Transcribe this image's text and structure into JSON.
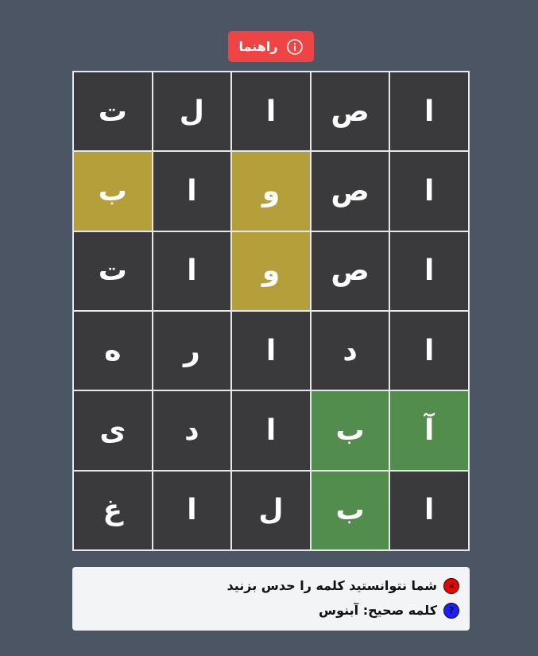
{
  "help_button": {
    "label": "راهنما",
    "icon": "info-icon"
  },
  "grid": [
    [
      {
        "letter": "ا",
        "state": "absent"
      },
      {
        "letter": "ص",
        "state": "absent"
      },
      {
        "letter": "ا",
        "state": "absent"
      },
      {
        "letter": "ل",
        "state": "absent"
      },
      {
        "letter": "ت",
        "state": "absent"
      }
    ],
    [
      {
        "letter": "ا",
        "state": "absent"
      },
      {
        "letter": "ص",
        "state": "absent"
      },
      {
        "letter": "و",
        "state": "present"
      },
      {
        "letter": "ا",
        "state": "absent"
      },
      {
        "letter": "ب",
        "state": "present"
      }
    ],
    [
      {
        "letter": "ا",
        "state": "absent"
      },
      {
        "letter": "ص",
        "state": "absent"
      },
      {
        "letter": "و",
        "state": "present"
      },
      {
        "letter": "ا",
        "state": "absent"
      },
      {
        "letter": "ت",
        "state": "absent"
      }
    ],
    [
      {
        "letter": "ا",
        "state": "absent"
      },
      {
        "letter": "د",
        "state": "absent"
      },
      {
        "letter": "ا",
        "state": "absent"
      },
      {
        "letter": "ر",
        "state": "absent"
      },
      {
        "letter": "ه",
        "state": "absent"
      }
    ],
    [
      {
        "letter": "آ",
        "state": "correct"
      },
      {
        "letter": "ب",
        "state": "correct"
      },
      {
        "letter": "ا",
        "state": "absent"
      },
      {
        "letter": "د",
        "state": "absent"
      },
      {
        "letter": "ی",
        "state": "absent"
      }
    ],
    [
      {
        "letter": "ا",
        "state": "absent"
      },
      {
        "letter": "ب",
        "state": "correct"
      },
      {
        "letter": "ل",
        "state": "absent"
      },
      {
        "letter": "ا",
        "state": "absent"
      },
      {
        "letter": "غ",
        "state": "absent"
      }
    ]
  ],
  "colors": {
    "background": "#4b5563",
    "absent": "#3a3a3c",
    "present": "#b59f3b",
    "correct": "#538d4e",
    "help_button": "#ef4444"
  },
  "messages": {
    "fail": {
      "icon": "x-circle-icon",
      "glyph": "×",
      "text": "شما نتوانستید کلمه را حدس بزنید"
    },
    "answer": {
      "icon": "question-circle-icon",
      "glyph": "?",
      "text": "کلمه صحیح: آبنوس"
    }
  }
}
